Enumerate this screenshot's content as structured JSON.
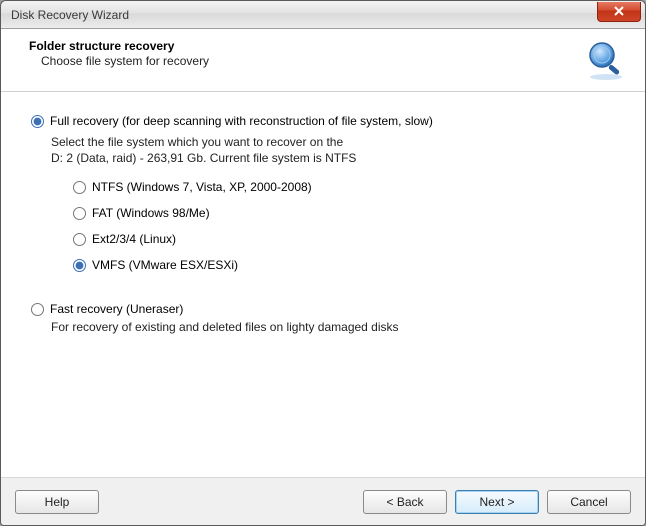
{
  "window": {
    "title": "Disk Recovery Wizard"
  },
  "header": {
    "title": "Folder structure recovery",
    "subtitle": "Choose file system for recovery"
  },
  "full": {
    "label": "Full recovery (for deep scanning with reconstruction of file system, slow)",
    "desc_line1": "Select the file system which you want to recover on the",
    "desc_line2": "D: 2 (Data, raid) - 263,91 Gb. Current file system is NTFS",
    "selected": true
  },
  "filesystems": [
    {
      "label": "NTFS (Windows 7, Vista, XP, 2000-2008)",
      "selected": false
    },
    {
      "label": "FAT (Windows 98/Me)",
      "selected": false
    },
    {
      "label": "Ext2/3/4 (Linux)",
      "selected": false
    },
    {
      "label": "VMFS (VMware ESX/ESXi)",
      "selected": true
    }
  ],
  "fast": {
    "label": "Fast recovery (Uneraser)",
    "desc": "For recovery of existing and deleted files on lighty damaged disks",
    "selected": false
  },
  "buttons": {
    "help": "Help",
    "back": "< Back",
    "next": "Next >",
    "cancel": "Cancel"
  }
}
